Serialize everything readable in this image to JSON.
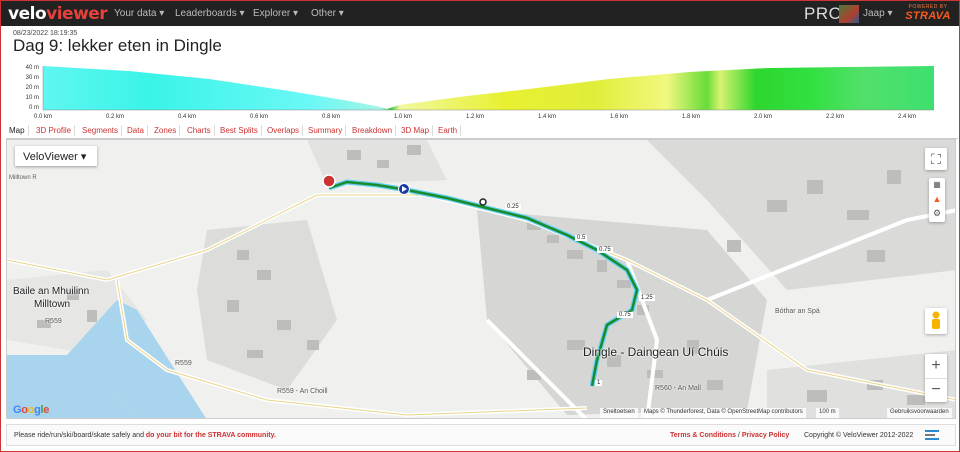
{
  "nav": {
    "brand_part1": "velo",
    "brand_part2": "viewer",
    "menu": [
      "Your data",
      "Leaderboards",
      "Explorer",
      "Other"
    ],
    "pro_label": "PRO",
    "user_name": "Jaap",
    "strava_powered": "POWERED BY",
    "strava_name": "STRAVA"
  },
  "activity": {
    "datetime": "08/23/2022 18:19:35",
    "title": "Dag 9: lekker eten in Dingle"
  },
  "elevation": {
    "y_ticks": [
      "40 m",
      "30 m",
      "20 m",
      "10 m",
      "0 m"
    ],
    "x_ticks": [
      "0.0 km",
      "0.2 km",
      "0.4 km",
      "0.6 km",
      "0.8 km",
      "1.0 km",
      "1.2 km",
      "1.4 km",
      "1.6 km",
      "1.8 km",
      "2.0 km",
      "2.2 km",
      "2.4 km"
    ]
  },
  "tabs": [
    "Map",
    "3D Profile",
    "Segments",
    "Data",
    "Zones",
    "Charts",
    "Best Splits",
    "Overlaps",
    "Summary",
    "Breakdown",
    "3D Map",
    "Earth"
  ],
  "map": {
    "layer_select": "VeloViewer",
    "labels": {
      "baile": "Baile an Mhuilinn",
      "milltown": "Milltown",
      "dingle": "Dingle - Daingean Uí Chúis",
      "r559a": "R559",
      "r559b": "R559 - An Choill",
      "r560": "R560 - An Mall",
      "bothar": "Bóthar an Spá",
      "r559c": "R559",
      "milltown_r": "Milltown R"
    },
    "route_markers": [
      "0.25",
      "0.5",
      "0.75",
      "1.25",
      "0.75",
      "1"
    ],
    "attribution": {
      "shortcuts": "Sneltoetsen",
      "mapdata": "Maps © Thunderforest, Data © OpenStreetMap contributors",
      "scale": "100 m",
      "terms": "Gebruiksvoorwaarden",
      "google": "Google"
    },
    "controls": {
      "zoom_in": "+",
      "zoom_out": "−"
    }
  },
  "footer": {
    "text_before": "Please ride/run/ski/board/skate safely and ",
    "text_red": "do your bit for the STRAVA community.",
    "terms": "Terms & Conditions",
    "separator": " / ",
    "privacy": "Privacy Policy",
    "copyright": "Copyright © VeloViewer 2012-2022"
  },
  "colors": {
    "accent": "#cc3333",
    "strava": "#fc4c02",
    "water": "#9fd0ee",
    "route_green": "#1a8a2a",
    "route_blue": "#2a6ac8"
  }
}
